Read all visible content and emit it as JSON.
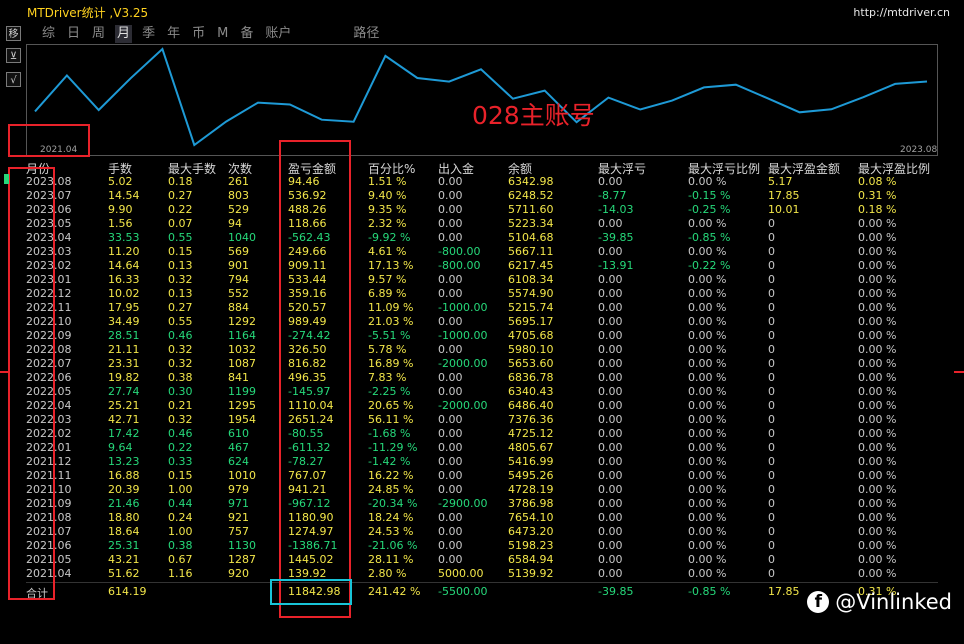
{
  "app": {
    "title": "MTDriver统计 ,V3.25",
    "url": "http://mtdriver.cn"
  },
  "side_buttons": [
    "移",
    "⊻",
    "√"
  ],
  "tabs": [
    "综",
    "日",
    "周",
    "月",
    "季",
    "年",
    "币",
    "M",
    "备",
    "账户",
    "路径"
  ],
  "active_tab": "月",
  "chart": {
    "account_label": "028主账号",
    "x_start": "2021.04",
    "x_end": "2023.08",
    "line_color": "#1e9ad6"
  },
  "colors": {
    "positive": "#f2e64a",
    "negative": "#26d87a",
    "neutral": "#c8c8c8",
    "annotation": "#e8222a"
  },
  "table": {
    "columns": [
      "月份",
      "手数",
      "最大手数",
      "次数",
      "盈亏金额",
      "百分比%",
      "出入金",
      "余额",
      "最大浮亏",
      "最大浮亏比例",
      "最大浮盈金额",
      "最大浮盈比例"
    ],
    "rows": [
      [
        "2023.08",
        "5.02",
        "0.18",
        "261",
        "94.46",
        "1.51 %",
        "0.00",
        "6342.98",
        "0.00",
        "0.00 %",
        "5.17",
        "0.08 %"
      ],
      [
        "2023.07",
        "14.54",
        "0.27",
        "803",
        "536.92",
        "9.40 %",
        "0.00",
        "6248.52",
        "-8.77",
        "-0.15 %",
        "17.85",
        "0.31 %"
      ],
      [
        "2023.06",
        "9.90",
        "0.22",
        "529",
        "488.26",
        "9.35 %",
        "0.00",
        "5711.60",
        "-14.03",
        "-0.25 %",
        "10.01",
        "0.18 %"
      ],
      [
        "2023.05",
        "1.56",
        "0.07",
        "94",
        "118.66",
        "2.32 %",
        "0.00",
        "5223.34",
        "0.00",
        "0.00 %",
        "0",
        "0.00 %"
      ],
      [
        "2023.04",
        "33.53",
        "0.55",
        "1040",
        "-562.43",
        "-9.92 %",
        "0.00",
        "5104.68",
        "-39.85",
        "-0.85 %",
        "0",
        "0.00 %"
      ],
      [
        "2023.03",
        "11.20",
        "0.15",
        "569",
        "249.66",
        "4.61 %",
        "-800.00",
        "5667.11",
        "0.00",
        "0.00 %",
        "0",
        "0.00 %"
      ],
      [
        "2023.02",
        "14.64",
        "0.13",
        "901",
        "909.11",
        "17.13 %",
        "-800.00",
        "6217.45",
        "-13.91",
        "-0.22 %",
        "0",
        "0.00 %"
      ],
      [
        "2023.01",
        "16.33",
        "0.32",
        "794",
        "533.44",
        "9.57 %",
        "0.00",
        "6108.34",
        "0.00",
        "0.00 %",
        "0",
        "0.00 %"
      ],
      [
        "2022.12",
        "10.02",
        "0.13",
        "552",
        "359.16",
        "6.89 %",
        "0.00",
        "5574.90",
        "0.00",
        "0.00 %",
        "0",
        "0.00 %"
      ],
      [
        "2022.11",
        "17.95",
        "0.27",
        "884",
        "520.57",
        "11.09 %",
        "-1000.00",
        "5215.74",
        "0.00",
        "0.00 %",
        "0",
        "0.00 %"
      ],
      [
        "2022.10",
        "34.49",
        "0.55",
        "1292",
        "989.49",
        "21.03 %",
        "0.00",
        "5695.17",
        "0.00",
        "0.00 %",
        "0",
        "0.00 %"
      ],
      [
        "2022.09",
        "28.51",
        "0.46",
        "1164",
        "-274.42",
        "-5.51 %",
        "-1000.00",
        "4705.68",
        "0.00",
        "0.00 %",
        "0",
        "0.00 %"
      ],
      [
        "2022.08",
        "21.11",
        "0.32",
        "1032",
        "326.50",
        "5.78 %",
        "0.00",
        "5980.10",
        "0.00",
        "0.00 %",
        "0",
        "0.00 %"
      ],
      [
        "2022.07",
        "23.31",
        "0.32",
        "1087",
        "816.82",
        "16.89 %",
        "-2000.00",
        "5653.60",
        "0.00",
        "0.00 %",
        "0",
        "0.00 %"
      ],
      [
        "2022.06",
        "19.82",
        "0.38",
        "841",
        "496.35",
        "7.83 %",
        "0.00",
        "6836.78",
        "0.00",
        "0.00 %",
        "0",
        "0.00 %"
      ],
      [
        "2022.05",
        "27.74",
        "0.30",
        "1199",
        "-145.97",
        "-2.25 %",
        "0.00",
        "6340.43",
        "0.00",
        "0.00 %",
        "0",
        "0.00 %"
      ],
      [
        "2022.04",
        "25.21",
        "0.21",
        "1295",
        "1110.04",
        "20.65 %",
        "-2000.00",
        "6486.40",
        "0.00",
        "0.00 %",
        "0",
        "0.00 %"
      ],
      [
        "2022.03",
        "42.71",
        "0.32",
        "1954",
        "2651.24",
        "56.11 %",
        "0.00",
        "7376.36",
        "0.00",
        "0.00 %",
        "0",
        "0.00 %"
      ],
      [
        "2022.02",
        "17.42",
        "0.46",
        "610",
        "-80.55",
        "-1.68 %",
        "0.00",
        "4725.12",
        "0.00",
        "0.00 %",
        "0",
        "0.00 %"
      ],
      [
        "2022.01",
        "9.64",
        "0.22",
        "467",
        "-611.32",
        "-11.29 %",
        "0.00",
        "4805.67",
        "0.00",
        "0.00 %",
        "0",
        "0.00 %"
      ],
      [
        "2021.12",
        "13.23",
        "0.33",
        "624",
        "-78.27",
        "-1.42 %",
        "0.00",
        "5416.99",
        "0.00",
        "0.00 %",
        "0",
        "0.00 %"
      ],
      [
        "2021.11",
        "16.88",
        "0.15",
        "1010",
        "767.07",
        "16.22 %",
        "0.00",
        "5495.26",
        "0.00",
        "0.00 %",
        "0",
        "0.00 %"
      ],
      [
        "2021.10",
        "20.39",
        "1.00",
        "979",
        "941.21",
        "24.85 %",
        "0.00",
        "4728.19",
        "0.00",
        "0.00 %",
        "0",
        "0.00 %"
      ],
      [
        "2021.09",
        "21.46",
        "0.44",
        "971",
        "-967.12",
        "-20.34 %",
        "-2900.00",
        "3786.98",
        "0.00",
        "0.00 %",
        "0",
        "0.00 %"
      ],
      [
        "2021.08",
        "18.80",
        "0.24",
        "921",
        "1180.90",
        "18.24 %",
        "0.00",
        "7654.10",
        "0.00",
        "0.00 %",
        "0",
        "0.00 %"
      ],
      [
        "2021.07",
        "18.64",
        "1.00",
        "757",
        "1274.97",
        "24.53 %",
        "0.00",
        "6473.20",
        "0.00",
        "0.00 %",
        "0",
        "0.00 %"
      ],
      [
        "2021.06",
        "25.31",
        "0.38",
        "1130",
        "-1386.71",
        "-21.06 %",
        "0.00",
        "5198.23",
        "0.00",
        "0.00 %",
        "0",
        "0.00 %"
      ],
      [
        "2021.05",
        "43.21",
        "0.67",
        "1287",
        "1445.02",
        "28.11 %",
        "0.00",
        "6584.94",
        "0.00",
        "0.00 %",
        "0",
        "0.00 %"
      ],
      [
        "2021.04",
        "51.62",
        "1.16",
        "920",
        "139.92",
        "2.80 %",
        "5000.00",
        "5139.92",
        "0.00",
        "0.00 %",
        "0",
        "0.00 %"
      ]
    ],
    "total": [
      "合计",
      "614.19",
      "",
      "",
      "11842.98",
      "241.42 %",
      "-5500.00",
      "",
      "-39.85",
      "-0.85 %",
      "17.85",
      "0.31 %"
    ]
  },
  "watermark": {
    "icon": "facebook-icon",
    "text": "@Vinlinked"
  }
}
